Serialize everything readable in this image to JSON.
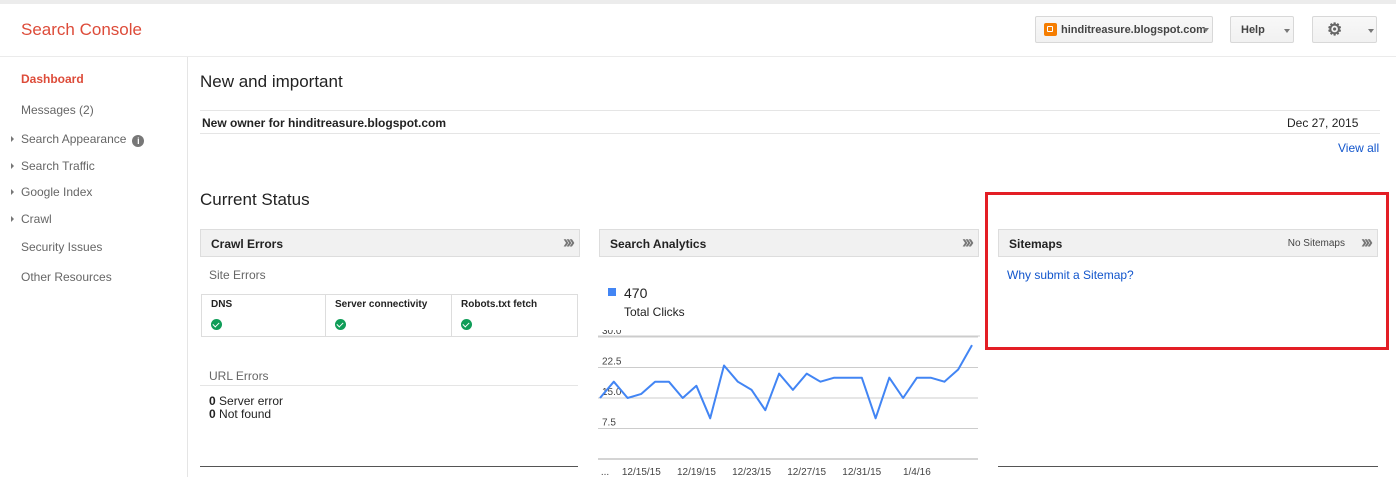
{
  "app": {
    "title": "Search Console"
  },
  "header": {
    "site": "hinditreasure.blogspot.com",
    "help_label": "Help",
    "gear_icon": "gear-icon"
  },
  "sidebar": {
    "items": [
      {
        "label": "Dashboard",
        "active": true
      },
      {
        "label": "Messages (2)"
      },
      {
        "label": "Search Appearance",
        "expandable": true,
        "info_icon": "i"
      },
      {
        "label": "Search Traffic",
        "expandable": true
      },
      {
        "label": "Google Index",
        "expandable": true
      },
      {
        "label": "Crawl",
        "expandable": true
      },
      {
        "label": "Security Issues"
      },
      {
        "label": "Other Resources"
      }
    ]
  },
  "main": {
    "new_important": {
      "title": "New and important",
      "messages": [
        {
          "text": "New owner for hinditreasure.blogspot.com",
          "date": "Dec 27, 2015"
        }
      ],
      "view_all": "View all"
    },
    "current_status": {
      "title": "Current Status",
      "crawl_errors": {
        "title": "Crawl Errors",
        "site_errors_label": "Site Errors",
        "site_errors": [
          {
            "label": "DNS",
            "status": "ok"
          },
          {
            "label": "Server connectivity",
            "status": "ok"
          },
          {
            "label": "Robots.txt fetch",
            "status": "ok"
          }
        ],
        "url_errors_label": "URL Errors",
        "url_errors": [
          {
            "count": "0",
            "label": "Server error"
          },
          {
            "count": "0",
            "label": "Not found"
          }
        ]
      },
      "search_analytics": {
        "title": "Search Analytics",
        "total_clicks_value": "470",
        "total_clicks_label": "Total Clicks",
        "series_color": "#4285f4"
      },
      "sitemaps": {
        "title": "Sitemaps",
        "status": "No Sitemaps",
        "link": "Why submit a Sitemap?"
      }
    }
  },
  "chart_data": {
    "type": "line",
    "x": [
      "12/12/15",
      "12/13/15",
      "12/14/15",
      "12/15/15",
      "12/16/15",
      "12/17/15",
      "12/18/15",
      "12/19/15",
      "12/20/15",
      "12/21/15",
      "12/22/15",
      "12/23/15",
      "12/24/15",
      "12/25/15",
      "12/26/15",
      "12/27/15",
      "12/28/15",
      "12/29/15",
      "12/30/15",
      "12/31/15",
      "1/1/16",
      "1/2/16",
      "1/3/16",
      "1/4/16",
      "1/5/16",
      "1/6/16",
      "1/7/16",
      "1/8/16"
    ],
    "x_tick_labels": [
      "...",
      "12/15/15",
      "12/19/15",
      "12/23/15",
      "12/27/15",
      "12/31/15",
      "1/4/16"
    ],
    "y_tick_labels": [
      "30.0",
      "22.5",
      "15.0",
      "7.5"
    ],
    "series": [
      {
        "values": [
          15,
          19,
          15,
          16,
          19,
          19,
          15,
          18,
          10,
          23,
          19,
          17,
          12,
          21,
          17,
          21,
          19,
          20,
          20,
          20,
          10,
          20,
          15,
          20,
          20,
          19,
          22,
          28
        ]
      }
    ],
    "ylim": [
      0,
      30
    ],
    "grid": true
  }
}
